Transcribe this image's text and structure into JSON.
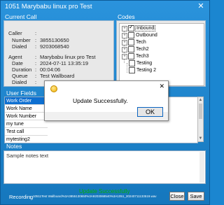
{
  "window": {
    "title": "1051 Marybabu linux pro Test",
    "close_glyph": "✕"
  },
  "current_call": {
    "section_title": "Current Call",
    "fields": [
      {
        "label": "Caller",
        "value": ""
      },
      {
        "label": "Number",
        "value": "3855130650"
      },
      {
        "label": "Dialed",
        "value": "9203068540"
      },
      {
        "label": "Agent",
        "value": "Marybabu linux pro Test"
      },
      {
        "label": "Date",
        "value": "2024-07-11 13:35:19"
      },
      {
        "label": "Duration",
        "value": "00:04:06"
      },
      {
        "label": "Queue",
        "value": "Test Wallboard"
      },
      {
        "label": "Dialed",
        "value": ""
      }
    ]
  },
  "codes": {
    "section_title": "Codes",
    "items": [
      {
        "label": "Inbound",
        "checked": true,
        "expandable": true,
        "selected": true
      },
      {
        "label": "Outbound",
        "checked": false,
        "expandable": true
      },
      {
        "label": "Tech",
        "checked": false,
        "expandable": true
      },
      {
        "label": "Tech2",
        "checked": false,
        "expandable": true
      },
      {
        "label": "Tech3",
        "checked": false,
        "expandable": true
      },
      {
        "label": "Testing",
        "checked": false,
        "expandable": false
      },
      {
        "label": "Testing 2",
        "checked": false,
        "expandable": false
      }
    ]
  },
  "user_fields": {
    "section_title": "User Fields",
    "rows": [
      "Work Order",
      "Work Name",
      "Work Number",
      "my tune",
      "Test call",
      "mytesting2"
    ]
  },
  "notes": {
    "section_title": "Notes",
    "text": "Sample notes text"
  },
  "footer": {
    "recording_label": "Recording",
    "recording_value": "10511Test Wallboard%3A3855130650%3A9203068540%3A1051_20240711133519.wav",
    "status_message": "Update Successfully",
    "close_label": "Close",
    "save_label": "Save"
  },
  "dialog": {
    "message": "Update Successfully.",
    "ok_label": "OK",
    "close_glyph": "✕"
  }
}
